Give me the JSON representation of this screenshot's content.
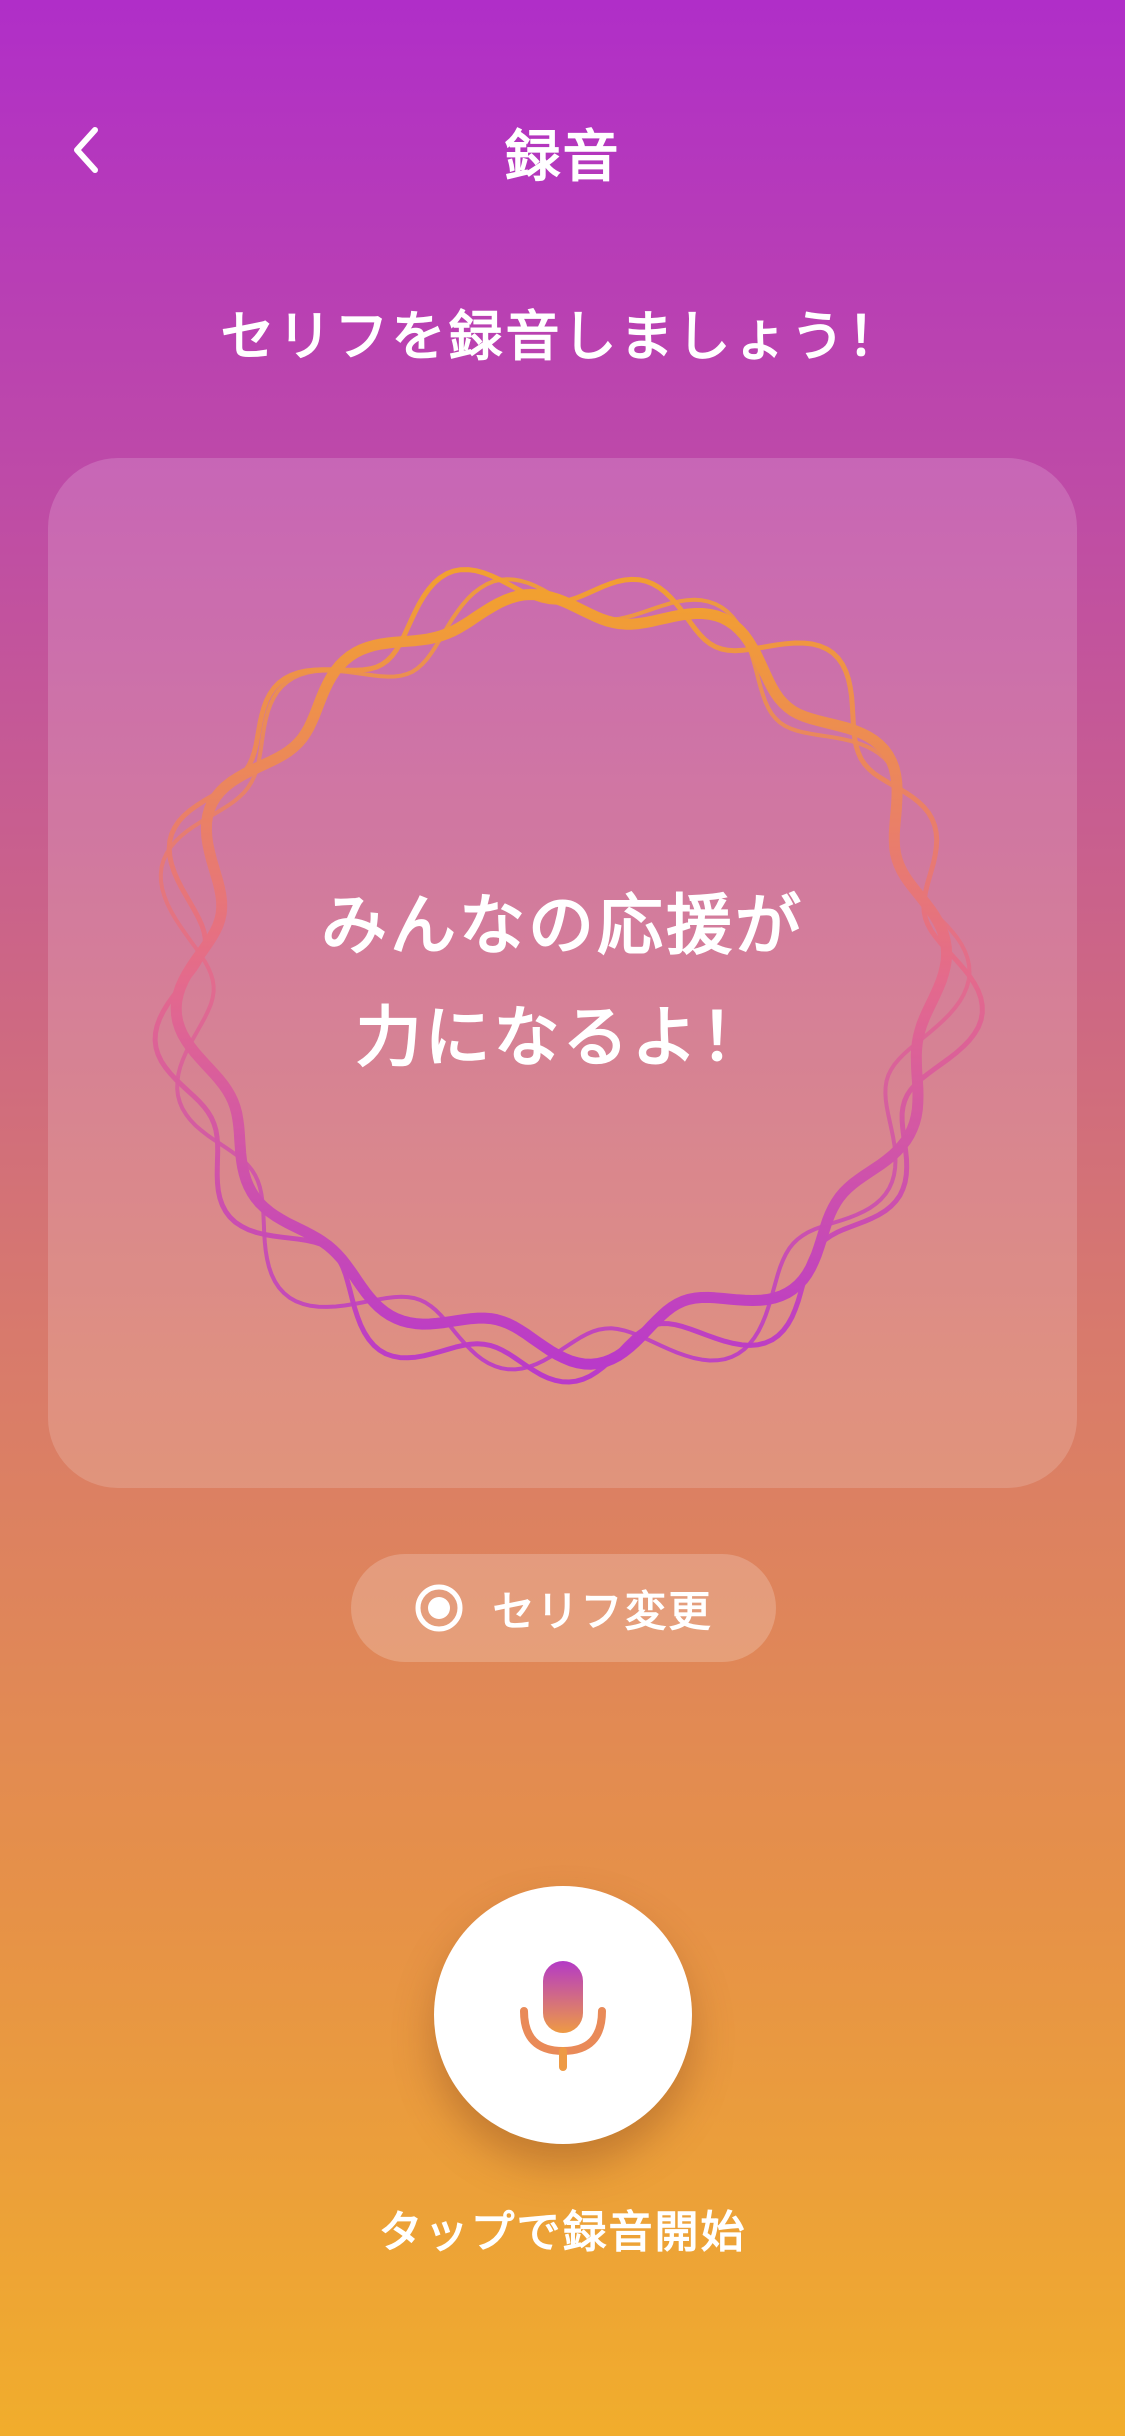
{
  "header": {
    "title": "録音",
    "back_icon": "chevron-left-icon"
  },
  "subtitle": "セリフを録音しましょう！",
  "card": {
    "line1": "みんなの応援が",
    "line2": "力になるよ！",
    "wave_colors": [
      "#f2a030",
      "#e46a8c",
      "#b93ac9"
    ]
  },
  "change_button": {
    "label": "セリフ変更",
    "icon": "radio-selected-icon"
  },
  "record": {
    "icon": "microphone-icon",
    "hint": "タップで録音開始"
  },
  "colors": {
    "gradient_top": "#b02ec8",
    "gradient_bottom": "#f1ad2c"
  }
}
